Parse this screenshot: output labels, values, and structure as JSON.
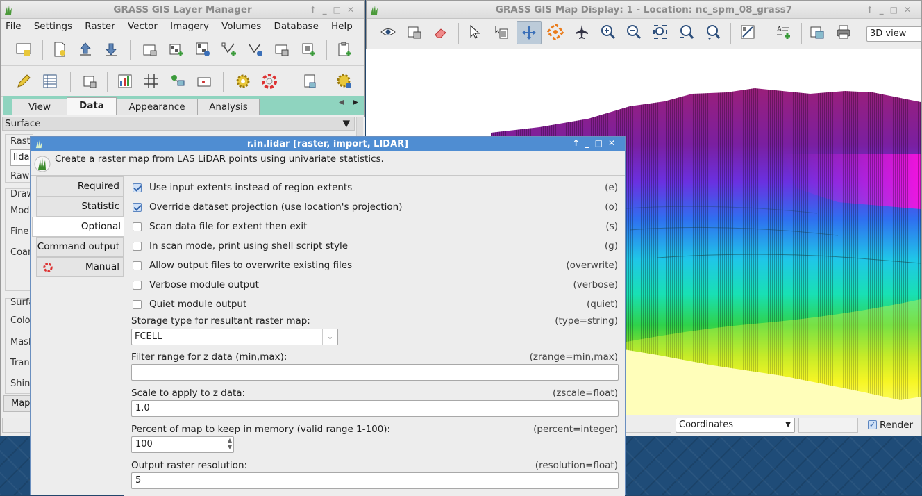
{
  "layer_manager": {
    "title": "GRASS GIS Layer Manager",
    "menu": [
      "File",
      "Settings",
      "Raster",
      "Vector",
      "Imagery",
      "Volumes",
      "Database",
      "Help"
    ],
    "tabs": [
      "View",
      "Data",
      "Appearance",
      "Analysis"
    ],
    "active_tab": "Data",
    "section": "Surface",
    "partial_labels": [
      "Rast",
      "lidar",
      "Raw",
      "Draw",
      "Mode",
      "Fine",
      "Coar",
      "Surfa",
      "Colo",
      "Mask",
      "Trans",
      "Shin",
      "Map"
    ]
  },
  "map_display": {
    "title": "GRASS GIS Map Display: 1  - Location: nc_spm_08_grass7",
    "view_mode": "3D view",
    "status_mode": "Coordinates",
    "render_label": "Render"
  },
  "dialog": {
    "title": "r.in.lidar [raster, import, LIDAR]",
    "description": "Create a raster map from LAS LiDAR points using univariate statistics.",
    "side_tabs": [
      "Required",
      "Statistic",
      "Optional",
      "Command output",
      "Manual"
    ],
    "active_tab": "Optional",
    "flags": [
      {
        "label": "Use input extents instead of region extents",
        "key": "(e)",
        "checked": true
      },
      {
        "label": "Override dataset projection (use location's projection)",
        "key": "(o)",
        "checked": true
      },
      {
        "label": "Scan data file for extent then exit",
        "key": "(s)",
        "checked": false
      },
      {
        "label": "In scan mode, print using shell script style",
        "key": "(g)",
        "checked": false
      },
      {
        "label": "Allow output files to overwrite existing files",
        "key": "(overwrite)",
        "checked": false
      },
      {
        "label": "Verbose module output",
        "key": "(verbose)",
        "checked": false
      },
      {
        "label": "Quiet module output",
        "key": "(quiet)",
        "checked": false
      }
    ],
    "storage": {
      "label": "Storage type for resultant raster map:",
      "key": "(type=string)",
      "value": "FCELL"
    },
    "zrange": {
      "label": "Filter range for z data (min,max):",
      "key": "(zrange=min,max)",
      "value": ""
    },
    "zscale": {
      "label": "Scale to apply to z data:",
      "key": "(zscale=float)",
      "value": "1.0"
    },
    "percent": {
      "label": "Percent of map to keep in memory (valid range 1-100):",
      "key": "(percent=integer)",
      "value": "100"
    },
    "resolution": {
      "label": "Output raster resolution:",
      "key": "(resolution=float)",
      "value": "5"
    }
  }
}
